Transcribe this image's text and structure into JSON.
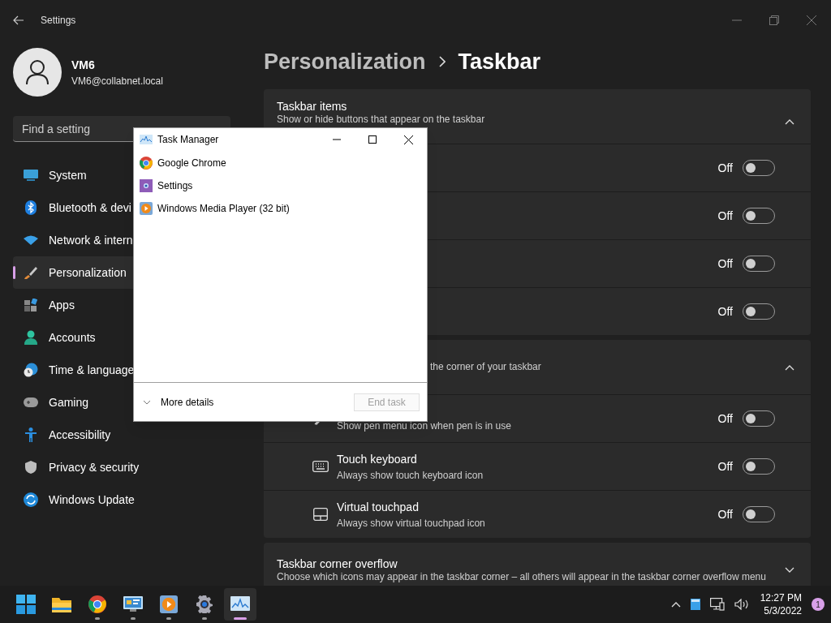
{
  "window": {
    "title": "Settings"
  },
  "user": {
    "name": "VM6",
    "email": "VM6@collabnet.local"
  },
  "search": {
    "placeholder": "Find a setting"
  },
  "sidebar": {
    "items": [
      {
        "label": "System",
        "kind": "display",
        "selected": false
      },
      {
        "label": "Bluetooth & devi",
        "kind": "bluetooth",
        "selected": false
      },
      {
        "label": "Network & intern",
        "kind": "wifi",
        "selected": false
      },
      {
        "label": "Personalization",
        "kind": "brush",
        "selected": true
      },
      {
        "label": "Apps",
        "kind": "apps",
        "selected": false
      },
      {
        "label": "Accounts",
        "kind": "person",
        "selected": false
      },
      {
        "label": "Time & language",
        "kind": "clock",
        "selected": false
      },
      {
        "label": "Gaming",
        "kind": "gamepad",
        "selected": false
      },
      {
        "label": "Accessibility",
        "kind": "accessibility",
        "selected": false
      },
      {
        "label": "Privacy & security",
        "kind": "shield",
        "selected": false
      },
      {
        "label": "Windows Update",
        "kind": "update",
        "selected": false
      }
    ]
  },
  "breadcrumb": [
    "Personalization",
    "Taskbar"
  ],
  "sections": [
    {
      "title": "Taskbar items",
      "subtitle": "Show or hide buttons that appear on the taskbar",
      "expanded": true,
      "rows": [
        {
          "state": "Off",
          "on": false
        },
        {
          "state": "Off",
          "on": false
        },
        {
          "state": "Off",
          "on": false
        },
        {
          "state": "Off",
          "on": false
        }
      ]
    },
    {
      "subtitle": "the corner of your taskbar",
      "expanded": true,
      "rows": [
        {
          "kind": "pen",
          "subtitle": "Show pen menu icon when pen is in use",
          "state": "Off",
          "on": false
        },
        {
          "kind": "keyboard",
          "title": "Touch keyboard",
          "subtitle": "Always show touch keyboard icon",
          "state": "Off",
          "on": false
        },
        {
          "kind": "touchpad",
          "title": "Virtual touchpad",
          "subtitle": "Always show virtual touchpad icon",
          "state": "Off",
          "on": false
        }
      ]
    },
    {
      "title": "Taskbar corner overflow",
      "subtitle": "Choose which icons may appear in the taskbar corner – all others will appear in the taskbar corner overflow menu",
      "expanded": false
    }
  ],
  "task_manager": {
    "title": "Task Manager",
    "apps": [
      {
        "name": "Google Chrome",
        "kind": "chrome"
      },
      {
        "name": "Settings",
        "kind": "settings"
      },
      {
        "name": "Windows Media Player (32 bit)",
        "kind": "media"
      }
    ],
    "more_details": "More details",
    "end_task": {
      "label": "End task",
      "disabled": true
    }
  },
  "taskbar": {
    "apps": [
      {
        "kind": "start",
        "running": false,
        "active": false
      },
      {
        "kind": "folder",
        "running": false,
        "active": false
      },
      {
        "kind": "chrome",
        "running": true,
        "active": false
      },
      {
        "kind": "panel",
        "running": true,
        "active": false
      },
      {
        "kind": "media",
        "running": true,
        "active": false
      },
      {
        "kind": "gear",
        "running": true,
        "active": false
      },
      {
        "kind": "monitor",
        "running": true,
        "active": true
      }
    ],
    "time": "12:27 PM",
    "date": "5/3/2022",
    "notifications": "1"
  }
}
